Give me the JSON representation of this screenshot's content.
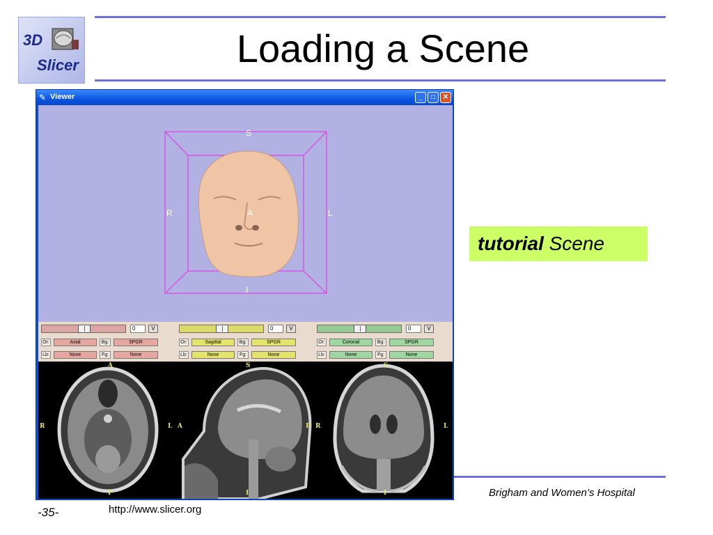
{
  "slide": {
    "title": "Loading a Scene",
    "logo_top": "3D",
    "logo_bottom": "Slicer",
    "callout_bold": "tutorial",
    "callout_rest": "Scene",
    "footer_org": "Brigham and Women’s Hospital",
    "page_number": "-35-",
    "url": "http://www.slicer.org",
    "colors": {
      "rule": "#6d70d8",
      "callout_bg": "#ccff66"
    }
  },
  "window": {
    "title": "Viewer",
    "icon": "feather-icon",
    "buttons": {
      "minimize": "_",
      "maximize": "□",
      "close": "✕"
    }
  },
  "view3d": {
    "labels": {
      "superior": "S",
      "inferior": "I",
      "right": "R",
      "left": "L",
      "anterior": "A"
    },
    "colors": {
      "background": "#b1b1e3",
      "box": "#e040e0",
      "face": "#efc5a6"
    }
  },
  "panels": [
    {
      "value": "0",
      "v_label": "V",
      "or_label": "Or:",
      "orientation": "Axial",
      "bg_label": "Bg:",
      "bg_value": "SPGR",
      "lb_label": "Lb:",
      "lb_value": "None",
      "fg_label": "Fg:",
      "fg_value": "None",
      "color": "#d9a5a5",
      "field_color": "#e6a7a0"
    },
    {
      "value": "0",
      "v_label": "V",
      "or_label": "Or:",
      "orientation": "Sagittal",
      "bg_label": "Bg:",
      "bg_value": "SPGR",
      "lb_label": "Lb:",
      "lb_value": "None",
      "fg_label": "Fg:",
      "fg_value": "None",
      "color": "#dada6a",
      "field_color": "#e4e46a"
    },
    {
      "value": "0",
      "v_label": "V",
      "or_label": "Or:",
      "orientation": "Coronal",
      "bg_label": "Bg:",
      "bg_value": "SPGR",
      "lb_label": "Lb:",
      "lb_value": "None",
      "fg_label": "Fg:",
      "fg_value": "None",
      "color": "#95c998",
      "field_color": "#9ed7a0"
    }
  ],
  "slice_labels": {
    "axial": {
      "top": "A",
      "bottom": "P",
      "left": "R",
      "right": "L"
    },
    "sagittal": {
      "top": "S",
      "bottom": "I",
      "left": "A",
      "right": "P"
    },
    "coronal": {
      "top": "S",
      "bottom": "I",
      "left": "R",
      "right": "L"
    }
  }
}
